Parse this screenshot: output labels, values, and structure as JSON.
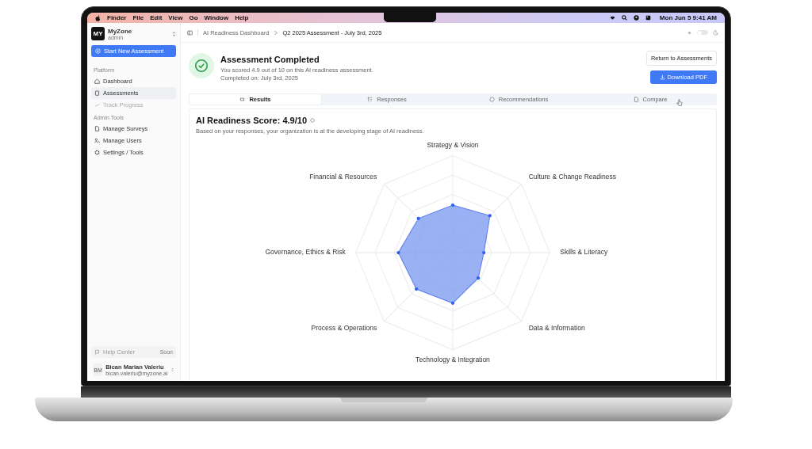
{
  "menu_bar": {
    "items": [
      "Finder",
      "File",
      "Edit",
      "View",
      "Go",
      "Window",
      "Help"
    ],
    "clock": "Mon Jun 5  9:41 AM"
  },
  "sidebar": {
    "team": {
      "logo": "MY",
      "name": "MyZone",
      "role": "admin"
    },
    "primary_button": "Start New Assessment",
    "sections": [
      {
        "title": "Platform",
        "items": [
          {
            "label": "Dashboard",
            "selected": false,
            "disabled": false
          },
          {
            "label": "Assessments",
            "selected": true,
            "disabled": false
          },
          {
            "label": "Track Progress",
            "selected": false,
            "disabled": true
          }
        ]
      },
      {
        "title": "Admin Tools",
        "items": [
          {
            "label": "Manage Surveys",
            "selected": false,
            "disabled": false
          },
          {
            "label": "Manage Users",
            "selected": false,
            "disabled": false
          },
          {
            "label": "Settings / Tools",
            "selected": false,
            "disabled": false
          }
        ]
      }
    ],
    "help": {
      "label": "Help Center",
      "badge": "Soon"
    },
    "user": {
      "initials": "BM",
      "name": "Bican Marian Valeriu",
      "email": "bican.valeriu@myzone.ai"
    }
  },
  "breadcrumb": [
    "AI Readiness Dashboard",
    "Q2 2025 Assessment - July 3rd, 2025"
  ],
  "theme_toggle": {
    "on": false
  },
  "result": {
    "title": "Assessment Completed",
    "lines": [
      "You scored 4.9 out of 10 on this AI readiness assessment.",
      "Completed on: July 3rd, 2025"
    ]
  },
  "buttons": {
    "secondary": "Return to Assessments",
    "primary": "Download PDF"
  },
  "tabs": [
    {
      "label": "Results",
      "selected": true
    },
    {
      "label": "Responses",
      "selected": false
    },
    {
      "label": "Recommendations",
      "selected": false
    },
    {
      "label": "Compare",
      "selected": false
    }
  ],
  "score_card": {
    "title": "AI Readiness Score: 4.9/10",
    "subtitle": "Based on your responses, your organization is at the developing stage of AI readiness.",
    "radar_axes": [
      "Strategy & Vision",
      "Culture & Change Readiness",
      "Skills & Literacy",
      "Data & Information",
      "Technology & Integration",
      "Process & Operations",
      "Governance, Ethics & Risk",
      "Financial & Resources"
    ]
  }
}
